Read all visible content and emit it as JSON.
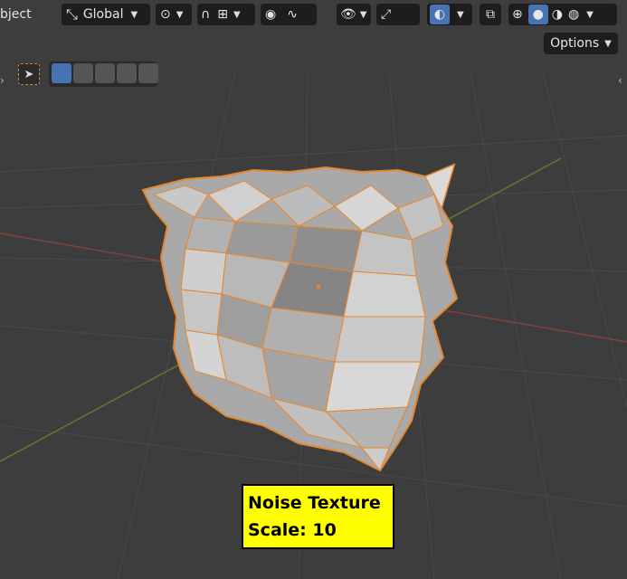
{
  "header": {
    "mode_label": "bject",
    "transform_orientation": "Global",
    "options_label": "Options"
  },
  "overlay": {
    "line1": "Noise Texture",
    "line2": "Scale: 10"
  },
  "colors": {
    "viewport_bg": "#3d3d3d",
    "header_btn_bg": "#1d1d1d",
    "active_blue": "#4772b3",
    "selection_outline": "#e8862c",
    "mesh_face": "#b9b9b9",
    "label_bg": "#ffff00"
  },
  "icons": [
    "transform-orientation-icon",
    "pivot-icon",
    "snap-icon",
    "snap-increment-icon",
    "proportional-edit-icon",
    "falloff-icon",
    "visibility-icon",
    "gizmo-icon",
    "overlay-icon",
    "xray-icon",
    "wireframe-shading-icon",
    "solid-shading-icon",
    "material-shading-icon",
    "rendered-shading-icon",
    "select-tool-icon",
    "select-box-icon"
  ]
}
